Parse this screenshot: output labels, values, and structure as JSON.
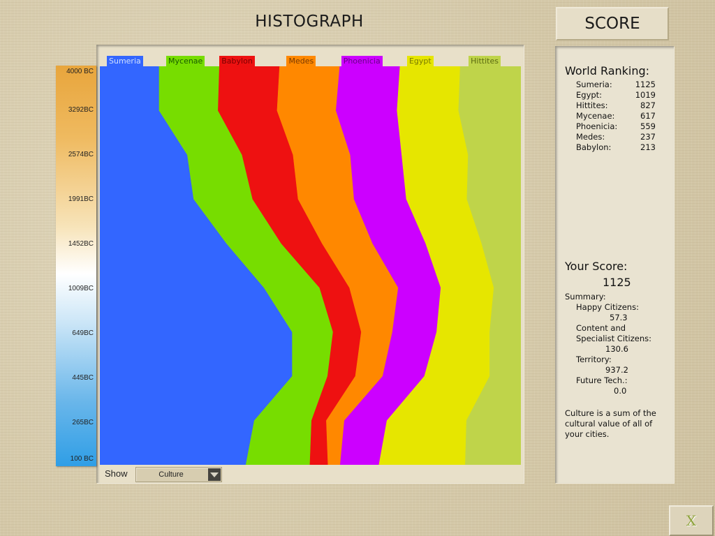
{
  "header": {
    "title": "HISTOGRAPH",
    "score_tab": "SCORE"
  },
  "timeline": {
    "ticks": [
      "4000 BC",
      "3292BC",
      "2574BC",
      "1991BC",
      "1452BC",
      "1009BC",
      "649BC",
      "445BC",
      "265BC",
      "100 BC"
    ]
  },
  "chart_data": {
    "type": "area",
    "orientation": "vertical-time",
    "metric": "Culture",
    "time_labels": [
      "4000 BC",
      "3292BC",
      "2574BC",
      "1991BC",
      "1452BC",
      "1009BC",
      "649BC",
      "445BC",
      "265BC",
      "100 BC"
    ],
    "series": [
      {
        "name": "Sumeria",
        "color": "#3366ff",
        "shares": [
          14.1,
          14.1,
          20.8,
          22.3,
          30.1,
          39.0,
          45.7,
          45.7,
          36.7,
          34.7
        ]
      },
      {
        "name": "Mycenae",
        "color": "#77dd00",
        "shares": [
          14.3,
          14.0,
          13.0,
          14.0,
          13.0,
          13.2,
          9.7,
          8.4,
          13.6,
          15.2
        ]
      },
      {
        "name": "Babylon",
        "color": "#ee1111",
        "shares": [
          14.3,
          14.0,
          12.1,
          10.8,
          9.7,
          7.1,
          6.7,
          6.6,
          3.5,
          4.3
        ]
      },
      {
        "name": "Medes",
        "color": "#ff8800",
        "shares": [
          14.3,
          14.0,
          13.6,
          13.3,
          12.0,
          11.6,
          7.4,
          6.5,
          4.3,
          2.9
        ]
      },
      {
        "name": "Phoenicia",
        "color": "#cc00ff",
        "shares": [
          14.3,
          14.5,
          12.2,
          12.4,
          12.6,
          10.1,
          10.5,
          9.9,
          10.1,
          9.2
        ]
      },
      {
        "name": "Egypt",
        "color": "#e6e600",
        "shares": [
          14.3,
          14.6,
          15.8,
          14.4,
          13.3,
          12.6,
          12.6,
          15.5,
          18.9,
          20.5
        ]
      },
      {
        "name": "Hittites",
        "color": "#bfd44a",
        "shares": [
          14.4,
          14.8,
          12.5,
          12.8,
          9.3,
          6.4,
          7.4,
          7.4,
          12.9,
          13.2
        ]
      }
    ]
  },
  "show": {
    "label": "Show",
    "value": "Culture"
  },
  "score": {
    "world_ranking_title": "World Ranking:",
    "rankings": [
      {
        "name": "Sumeria:",
        "score": "1125"
      },
      {
        "name": "Egypt:",
        "score": "1019"
      },
      {
        "name": "Hittites:",
        "score": "827"
      },
      {
        "name": "Mycenae:",
        "score": "617"
      },
      {
        "name": "Phoenicia:",
        "score": "559"
      },
      {
        "name": "Medes:",
        "score": "237"
      },
      {
        "name": "Babylon:",
        "score": "213"
      }
    ],
    "your_score_title": "Your Score:",
    "your_score_value": "1125",
    "summary_label": "Summary:",
    "happy_label": "Happy Citizens:",
    "happy_value": "57.3",
    "content_label_1": "Content and",
    "content_label_2": "Specialist Citizens:",
    "content_value": "130.6",
    "territory_label": "Territory:",
    "territory_value": "937.2",
    "future_label": "Future Tech.:",
    "future_value": "0.0",
    "note_lines": [
      "Culture is a sum of the",
      "cultural value of all of",
      "your cities."
    ]
  },
  "footer": {
    "close_glyph": "X"
  }
}
